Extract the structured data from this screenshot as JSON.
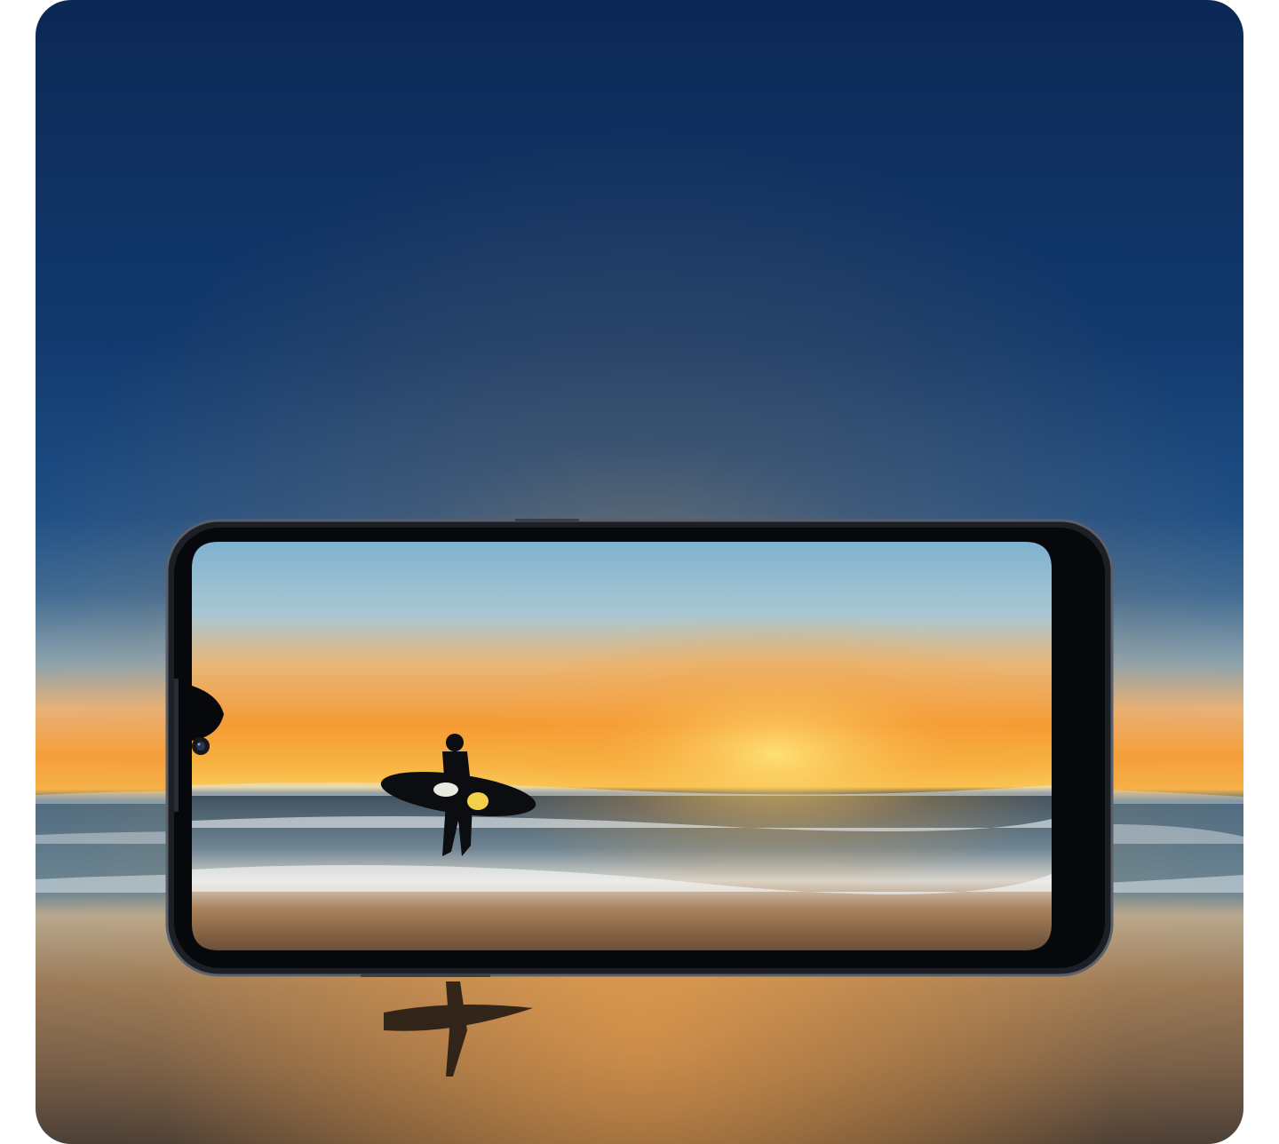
{
  "scene": {
    "description_items": [
      "surfer-silhouette",
      "surfboard",
      "sunset-sky",
      "ocean-waves",
      "wet-sand-reflection"
    ],
    "colors": {
      "sky_top": "#0d2a57",
      "sky_mid": "#1f4f86",
      "horizon_glow": "#f5a531",
      "sun": "#ffd968",
      "sea": "#4f6f86",
      "sand": "#6b5a4a",
      "phone_frame": "#1a1c22",
      "phone_bezel": "#08090c"
    }
  }
}
